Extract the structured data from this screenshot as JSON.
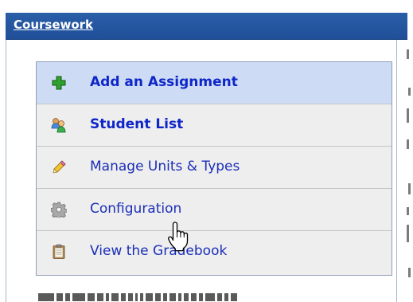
{
  "header": {
    "title": "Coursework"
  },
  "menu": {
    "items": [
      {
        "label": "Add an Assignment",
        "icon": "plus-icon",
        "style": "bold",
        "active": true
      },
      {
        "label": "Student List",
        "icon": "students-icon",
        "style": "bold",
        "active": false
      },
      {
        "label": "Manage Units & Types",
        "icon": "pencil-icon",
        "style": "normal",
        "active": false
      },
      {
        "label": "Configuration",
        "icon": "gear-icon",
        "style": "normal",
        "active": false
      },
      {
        "label": "View the Gradebook",
        "icon": "clipboard-icon",
        "style": "normal",
        "active": false
      }
    ]
  },
  "colors": {
    "header_bg": "#2a5ea8",
    "active_row": "#cddcf4",
    "row_bg": "#eeeeee",
    "link": "#1b2fb8"
  },
  "cursor": {
    "icon": "hand-pointer-icon"
  }
}
